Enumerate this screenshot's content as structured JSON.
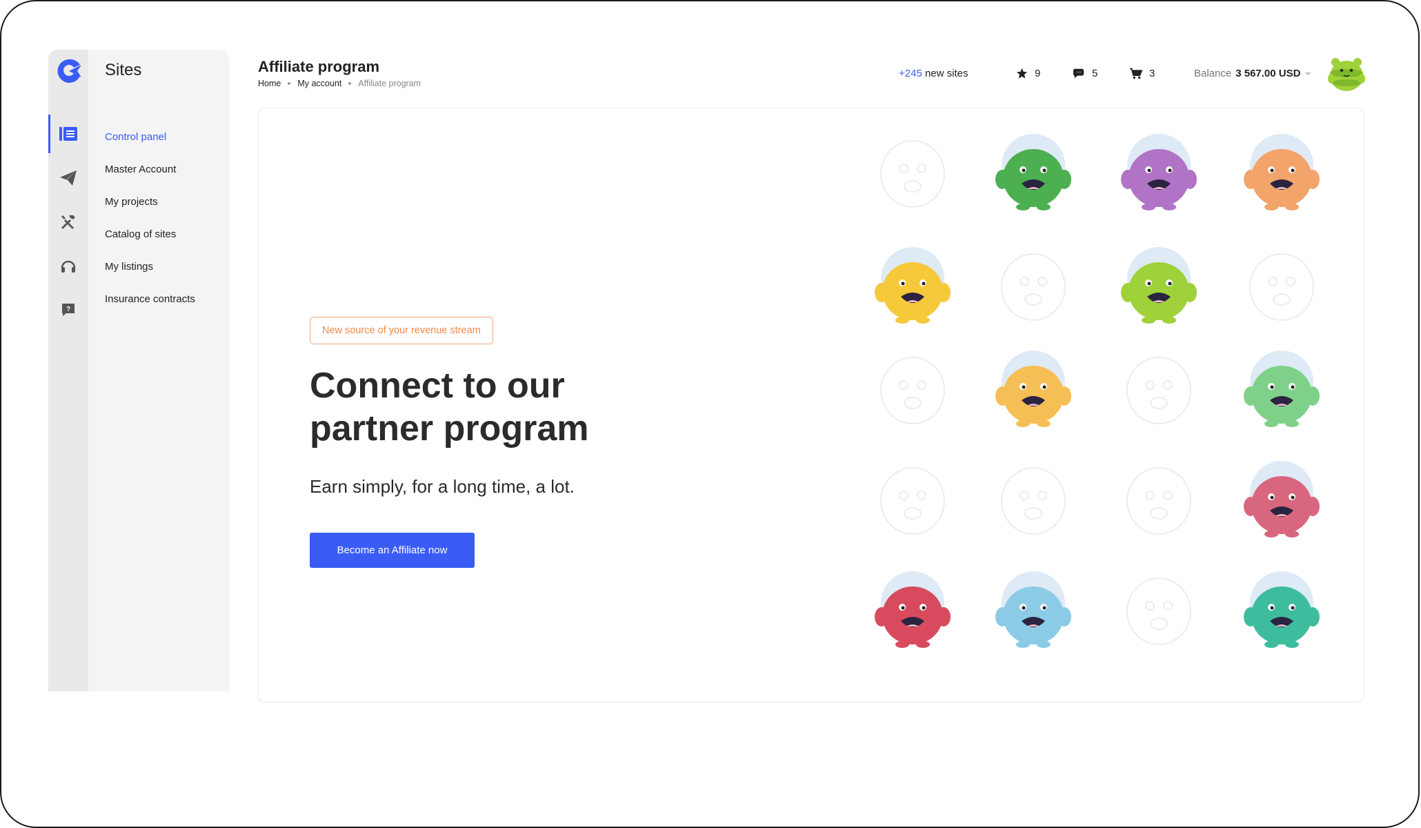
{
  "app": {
    "title": "Sites"
  },
  "colors": {
    "accent": "#3a5cf5",
    "badge": "#f08a4b",
    "rail": "#e9e9e9",
    "sidebar": "#f4f4f4"
  },
  "rail_icons": [
    "list-icon",
    "paper-plane-icon",
    "tools-icon",
    "headset-icon",
    "help-chat-icon"
  ],
  "sidebar": {
    "items": [
      {
        "label": "Control panel",
        "active": true
      },
      {
        "label": "Master Account"
      },
      {
        "label": "My projects"
      },
      {
        "label": "Catalog of sites"
      },
      {
        "label": "My listings"
      },
      {
        "label": "Insurance contracts"
      }
    ]
  },
  "header": {
    "title": "Affiliate program",
    "breadcrumb": [
      "Home",
      "My account",
      "Affiliate program"
    ],
    "new_sites": {
      "count": "+245",
      "label": "new sites"
    },
    "favorites": "9",
    "messages": "5",
    "cart": "3",
    "balance": {
      "label": "Balance",
      "value": "3 567.00 USD"
    }
  },
  "promo": {
    "badge": "New source of your revenue stream",
    "headline_line1": "Connect to our",
    "headline_line2": "partner program",
    "subtitle": "Earn simply, for a long time, a lot.",
    "cta": "Become an Affiliate now"
  },
  "monsters": [
    {
      "name": "ghost-outline",
      "color": null
    },
    {
      "name": "green-spiky",
      "color": "#4caf50"
    },
    {
      "name": "purple-tall",
      "color": "#b073c6"
    },
    {
      "name": "orange-fluffy",
      "color": "#f2a46b"
    },
    {
      "name": "yellow-horned",
      "color": "#f5c93a"
    },
    {
      "name": "outline",
      "color": null
    },
    {
      "name": "lime-striped",
      "color": "#9fd13a"
    },
    {
      "name": "cyclops-outline",
      "color": null
    },
    {
      "name": "outline",
      "color": null
    },
    {
      "name": "orange-blob",
      "color": "#f6bf55"
    },
    {
      "name": "outline",
      "color": null
    },
    {
      "name": "green-ghost",
      "color": "#7fd18a"
    },
    {
      "name": "outline",
      "color": null
    },
    {
      "name": "outline",
      "color": null
    },
    {
      "name": "unicorn-outline",
      "color": null
    },
    {
      "name": "pink-horned",
      "color": "#d9667f"
    },
    {
      "name": "red-unicorn",
      "color": "#d84b5e"
    },
    {
      "name": "blue-cyclops",
      "color": "#8ccbe6"
    },
    {
      "name": "outline",
      "color": null
    },
    {
      "name": "teal-fuzzy",
      "color": "#3dbd9d"
    }
  ]
}
